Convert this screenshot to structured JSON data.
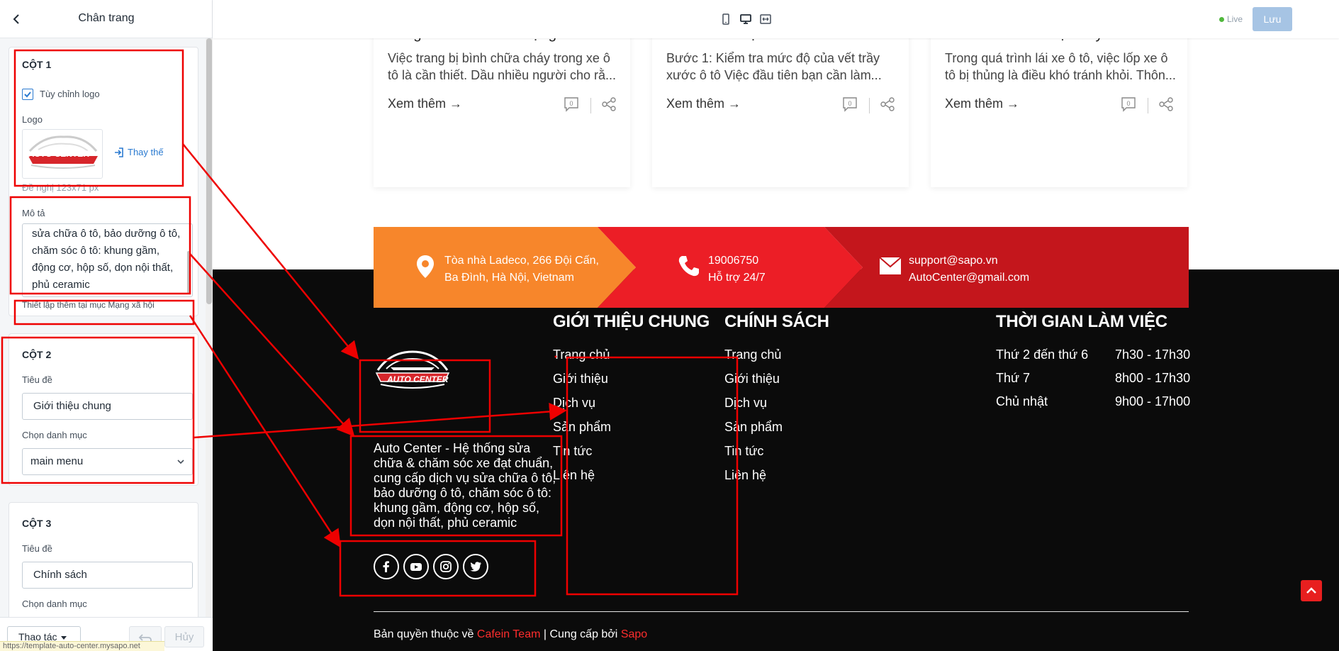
{
  "panel": {
    "title": "Chân trang",
    "col1": {
      "title": "CỘT 1",
      "custom_logo_label": "Tùy chỉnh logo",
      "custom_logo_checked": true,
      "logo_label": "Logo",
      "logo_text": "AUTO CENTER",
      "replace_label": "Thay thế",
      "hint": "Đề nghị 123x71 px",
      "desc_label": "Mô tả",
      "desc_value": "Auto Center - Hệ thống sửa chữa & chăm sóc xe đạt chuẩn, cung cấp dịch vụ sửa chữa ô tô, bảo dưỡng ô tô, chăm sóc ô tô: khung gầm, động cơ, hộp số, dọn nội thất, phủ ceramic",
      "desc_visible": "sửa chữa ô tô, bảo dưỡng ô tô, chăm sóc ô tô: khung gầm, động cơ, hộp số, dọn nội thất, phủ ceramic",
      "social_note": "Thiết lập thêm tại mục Mạng xã hội"
    },
    "col2": {
      "title": "CỘT 2",
      "title_label": "Tiêu đề",
      "title_value": "Giới thiệu chung",
      "menu_label": "Chọn danh mục",
      "menu_value": "main menu"
    },
    "col3": {
      "title": "CỘT 3",
      "title_label": "Tiêu đề",
      "title_value": "Chính sách",
      "menu_label": "Chọn danh mục"
    },
    "footer": {
      "action_label": "Thao tác",
      "cancel_label": "Hủy",
      "status_url": "https://template-auto-center.mysapo.net"
    }
  },
  "toolbar": {
    "devices": [
      "mobile-icon",
      "desktop-icon",
      "fullwidth-icon"
    ],
    "live_label": "Live",
    "save_label": "Lưu"
  },
  "posts": [
    {
      "title": "trong ô tô? Cách sử dụng bình...",
      "excerpt": "Việc trang bị bình chữa cháy trong xe ô tô là cần thiết. Dầu nhiều người cho rằ...",
      "more": "Xem thêm",
      "comments": "0"
    },
    {
      "title": "trên xe ô tô tại nhà",
      "excerpt": "Bước 1: Kiểm tra mức độ của vết trầy xước ô tô Việc đầu tiên bạn cần làm...",
      "more": "Xem thêm",
      "comments": "0"
    },
    {
      "title": "Xử khánh nhất hiện nay?",
      "excerpt": "Trong quá trình lái xe ô tô, việc lốp xe ô tô bị thủng là điều khó tránh khỏi. Thôn...",
      "more": "Xem thêm",
      "comments": "0"
    }
  ],
  "contact": {
    "address": [
      "Tòa nhà Ladeco, 266 Đội Cấn,",
      "Ba Đình, Hà Nội, Vietnam"
    ],
    "phone": [
      "19006750",
      "Hỗ trợ 24/7"
    ],
    "email": [
      "support@sapo.vn",
      "AutoCenter@gmail.com"
    ],
    "colors": {
      "orange": "#f7862b",
      "red": "#ec1e26",
      "darkred": "#c4161c"
    }
  },
  "site_footer": {
    "logo_text": "AUTO CENTER",
    "about": "Auto Center - Hệ thống sửa chữa & chăm sóc xe đạt chuẩn, cung cấp dịch vụ sửa chữa ô tô, bảo dưỡng ô tô, chăm sóc ô tô: khung gầm, động cơ, hộp số, dọn nội thất, phủ ceramic",
    "socials": [
      "facebook-icon",
      "youtube-icon",
      "instagram-icon",
      "twitter-icon"
    ],
    "col_intro": {
      "title": "GIỚI THIỆU CHUNG",
      "links": [
        "Trang chủ",
        "Giới thiệu",
        "Dịch vụ",
        "Sản phẩm",
        "Tin tức",
        "Liên hệ"
      ]
    },
    "col_policy": {
      "title": "CHÍNH SÁCH",
      "links": [
        "Trang chủ",
        "Giới thiệu",
        "Dịch vụ",
        "Sản phẩm",
        "Tin tức",
        "Liên hệ"
      ]
    },
    "col_hours": {
      "title": "THỜI GIAN LÀM VIỆC",
      "rows": [
        {
          "day": "Thứ 2 đến thứ 6",
          "time": "7h30 - 17h30"
        },
        {
          "day": "Thứ 7",
          "time": "8h00 - 17h30"
        },
        {
          "day": "Chủ nhật",
          "time": "9h00 - 17h00"
        }
      ]
    },
    "copyright": {
      "prefix": "Bản quyền thuộc về",
      "team": "Cafein Team",
      "mid": "| Cung cấp bởi",
      "provider": "Sapo"
    }
  }
}
